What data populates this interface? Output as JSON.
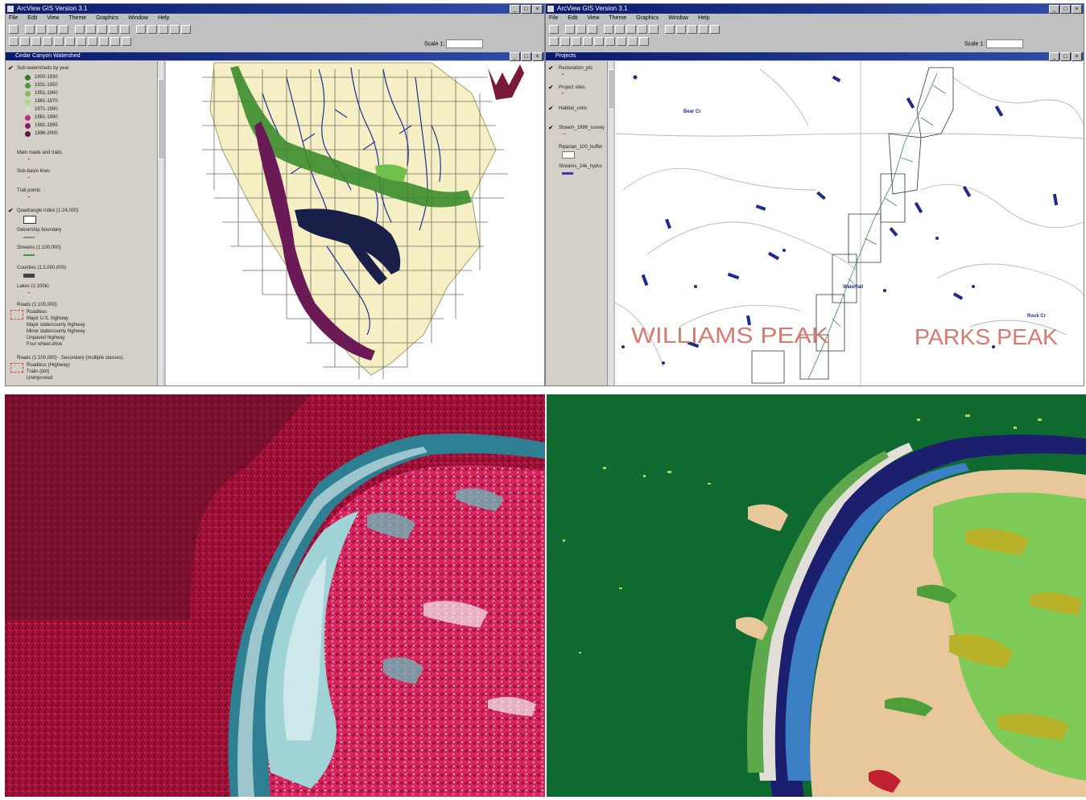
{
  "left_window": {
    "title": "ArcView GIS Version 3.1",
    "menu": [
      "File",
      "Edit",
      "View",
      "Theme",
      "Graphics",
      "Window",
      "Help"
    ],
    "scale_label": "Scale 1:",
    "view_title": "Cedar Canyon Watershed",
    "toc": [
      {
        "label": "Sub-watersheds by year",
        "checked": true
      },
      {
        "label": "Main roads and trails",
        "checked": false
      },
      {
        "label": "Sub-basin lines",
        "checked": false
      },
      {
        "label": "Trail points",
        "checked": false
      },
      {
        "label": "Quadrangle index (1:24,000)",
        "checked": true
      },
      {
        "label": "Ownership boundary",
        "checked": false
      },
      {
        "label": "Streams (1:100,000)",
        "checked": false
      },
      {
        "label": "Counties (1:2,000,000)",
        "checked": false
      },
      {
        "label": "Lakes (1:100k)",
        "checked": false
      },
      {
        "label": "Roads (1:100,000)",
        "checked": false
      },
      {
        "label": "Roads (1:100,000) - Secondary (multiple classes)",
        "checked": false
      }
    ],
    "legend_years": [
      "1900-1930",
      "1931-1950",
      "1951-1960",
      "1961-1970",
      "1971-1980",
      "1981-1990",
      "1991-1995",
      "1996-2000"
    ],
    "road_classes": [
      "Roadless",
      "Major U.S. highway",
      "Major state/county highway",
      "Minor state/county highway",
      "Unpaved highway",
      "Four wheel drive"
    ],
    "road_classes_2": [
      "Roadless (Highway)",
      "Trails (dirt)",
      "Unimproved"
    ]
  },
  "right_window": {
    "title": "ArcView GIS Version 3.1",
    "menu": [
      "File",
      "Edit",
      "View",
      "Theme",
      "Graphics",
      "Window",
      "Help"
    ],
    "scale_label": "Scale 1:",
    "view_title": "Projects",
    "toc": [
      {
        "label": "Restoration_pts",
        "checked": true
      },
      {
        "label": "Project sites",
        "checked": true
      },
      {
        "label": "Habitat_units",
        "checked": true
      },
      {
        "label": "Stream_1999_survey",
        "checked": true
      },
      {
        "label": "Riparian_100_buffer",
        "checked": false
      },
      {
        "label": "Streams_24k_hydro",
        "checked": false
      }
    ],
    "map_labels": {
      "williams": "WILLIAMS PEAK",
      "parks": "PARKS PEAK",
      "feature": "Waterfall",
      "north": "Bear Cr",
      "east": "Rock Cr"
    }
  },
  "colors": {
    "title_bar": "#0a1a6e",
    "window_gray": "#c0c0c0",
    "watershed_fill": "#f6efc3",
    "stream_blue": "#1c2fa0",
    "green_band": "#3c8c2c",
    "purple_band": "#6a1a55",
    "navy_band": "#1a1f4a",
    "ir_red": "#b0123e",
    "ir_dark": "#4a0f1e",
    "river_cyan": "#8ccfd4",
    "class_green": "#0e6a2e",
    "class_tan": "#e8c89a",
    "class_light_green": "#7ecb5a",
    "class_olive": "#b8b22a",
    "class_navy": "#1c1f6e"
  },
  "icons": [
    "window-icon",
    "minimize-icon",
    "maximize-icon",
    "close-icon",
    "checkbox-icon"
  ]
}
